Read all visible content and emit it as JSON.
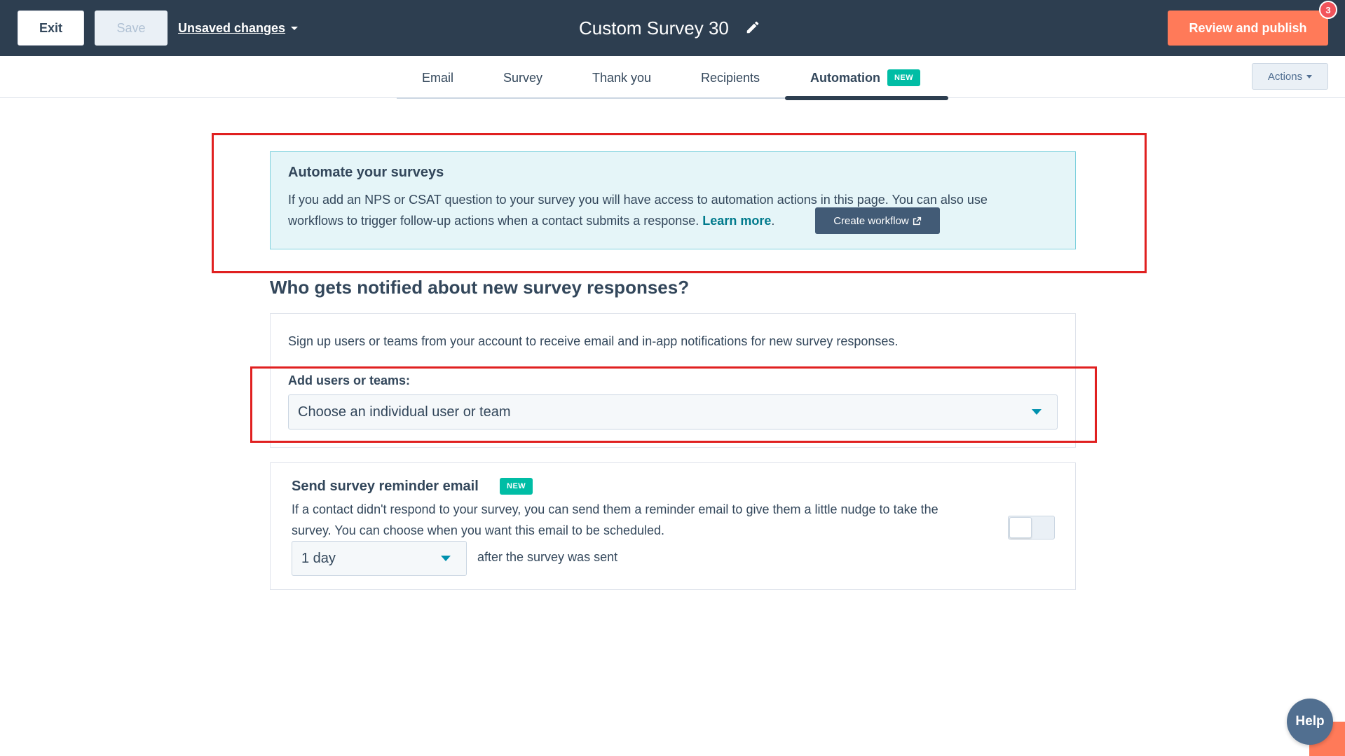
{
  "topbar": {
    "exit_label": "Exit",
    "save_label": "Save",
    "unsaved_label": "Unsaved changes",
    "title": "Custom Survey 30",
    "publish_label": "Review and publish",
    "notification_count": "3"
  },
  "tabs": [
    {
      "label": "Email"
    },
    {
      "label": "Survey"
    },
    {
      "label": "Thank you"
    },
    {
      "label": "Recipients"
    },
    {
      "label": "Automation",
      "badge": "NEW",
      "active": true
    }
  ],
  "actions_label": "Actions",
  "automate": {
    "title": "Automate your surveys",
    "text": "If you add an NPS or CSAT question to your survey you will have access to automation actions in this page. You can also use workflows to trigger follow-up actions when a contact submits a response.",
    "learn_more": "Learn more",
    "button_label": "Create workflow"
  },
  "notify": {
    "heading": "Who gets notified about new survey responses?",
    "description": "Sign up users or teams from your account to receive email and in-app notifications for new survey responses.",
    "add_label": "Add users or teams:",
    "select_placeholder": "Choose an individual user or team"
  },
  "reminder": {
    "title": "Send survey reminder email",
    "badge": "NEW",
    "text": "If a contact didn't respond to your survey, you can send them a reminder email to give them a little nudge to take the survey. You can choose when you want this email to be scheduled.",
    "delay_value": "1 day",
    "after_text": "after the survey was sent",
    "enabled": false
  },
  "help_label": "Help",
  "colors": {
    "topbar": "#2d3e50",
    "accent_orange": "#ff7a59",
    "teal_new": "#00bda5",
    "link": "#007a8c",
    "annotation_red": "#e02020"
  }
}
